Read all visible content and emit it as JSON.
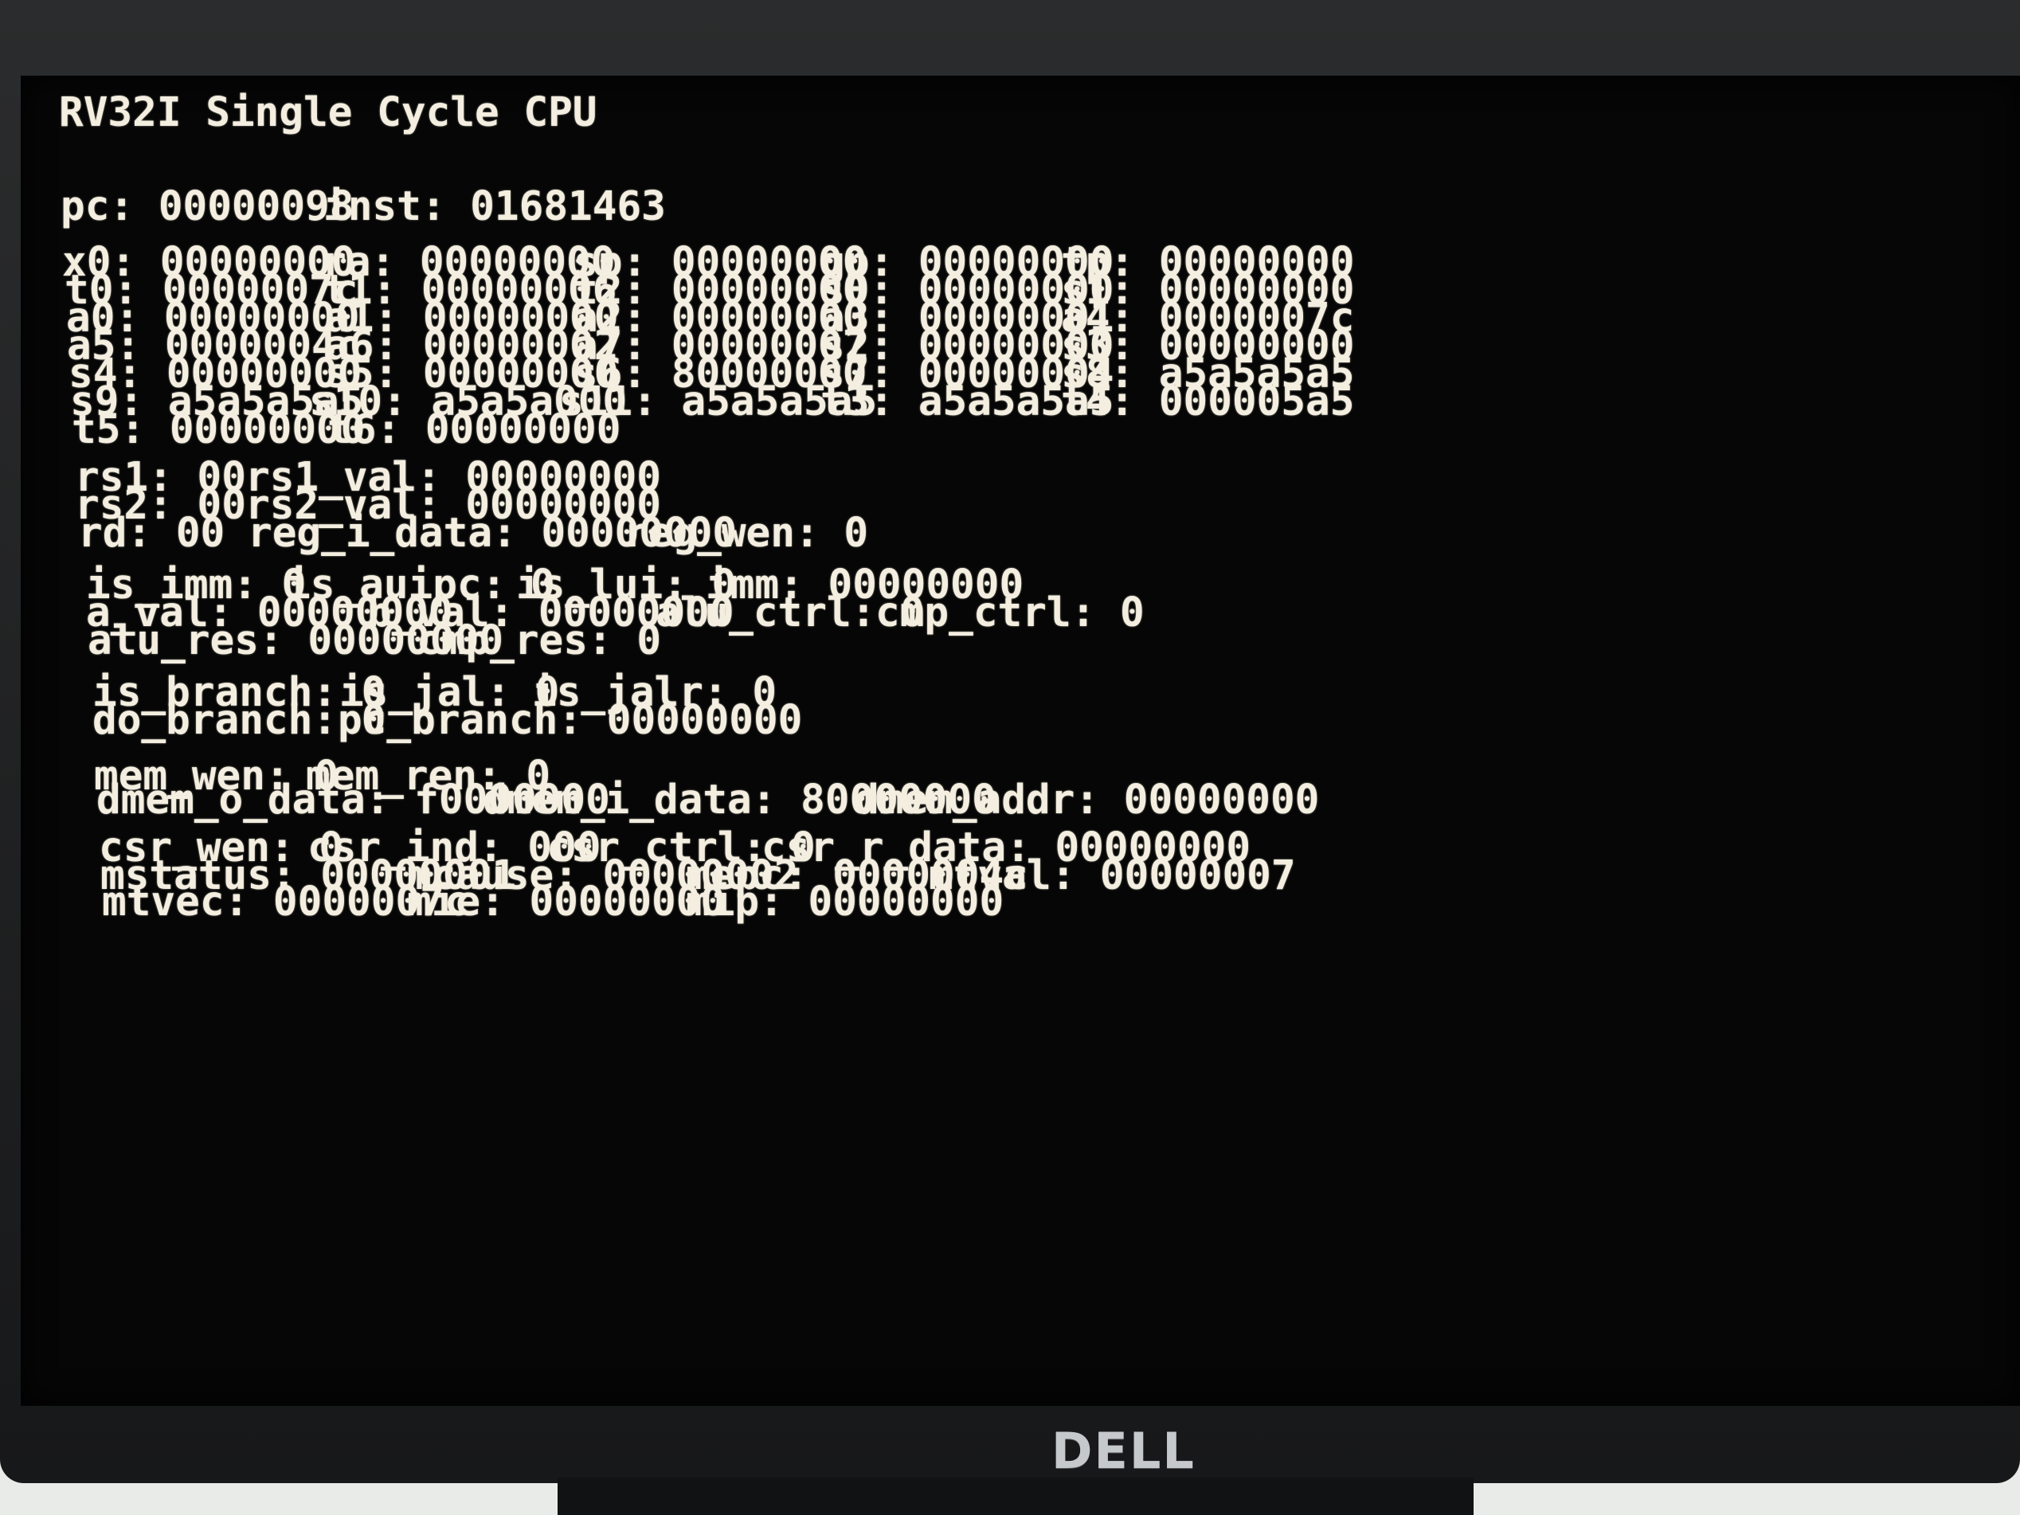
{
  "title": "RV32I Single Cycle CPU",
  "pc_line": [
    {
      "label": "pc:",
      "value": "00000098"
    },
    {
      "label": "inst:",
      "value": "01681463"
    }
  ],
  "registers": [
    [
      {
        "label": "x0:",
        "value": "00000000"
      },
      {
        "label": "ra:",
        "value": "00000000"
      },
      {
        "label": "sp:",
        "value": "00000000"
      },
      {
        "label": "gp:",
        "value": "00000000"
      },
      {
        "label": "tp:",
        "value": "00000000"
      }
    ],
    [
      {
        "label": "t0:",
        "value": "0000007c"
      },
      {
        "label": "t1:",
        "value": "00000006"
      },
      {
        "label": "t2:",
        "value": "00000000"
      },
      {
        "label": "s0:",
        "value": "00000000"
      },
      {
        "label": "s1:",
        "value": "00000000"
      }
    ],
    [
      {
        "label": "a0:",
        "value": "00000000"
      },
      {
        "label": "a1:",
        "value": "00000000"
      },
      {
        "label": "a2:",
        "value": "00000000"
      },
      {
        "label": "a3:",
        "value": "00000001"
      },
      {
        "label": "a4:",
        "value": "0000007c"
      }
    ],
    [
      {
        "label": "a5:",
        "value": "0000004c"
      },
      {
        "label": "a6:",
        "value": "00000002"
      },
      {
        "label": "a7:",
        "value": "00000007"
      },
      {
        "label": "s2:",
        "value": "00000000"
      },
      {
        "label": "s3:",
        "value": "00000000"
      }
    ],
    [
      {
        "label": "s4:",
        "value": "00000000"
      },
      {
        "label": "s5:",
        "value": "00000000"
      },
      {
        "label": "s6:",
        "value": "80000000"
      },
      {
        "label": "s7:",
        "value": "00000004"
      },
      {
        "label": "s8:",
        "value": "a5a5a5a5"
      }
    ],
    [
      {
        "label": "s9:",
        "value": "a5a5a5a5"
      },
      {
        "label": "s10:",
        "value": "a5a5a000"
      },
      {
        "label": "s11:",
        "value": "a5a5a5a5"
      },
      {
        "label": "t3:",
        "value": "a5a5a5a5"
      },
      {
        "label": "t4:",
        "value": "000005a5"
      }
    ],
    [
      {
        "label": "t5:",
        "value": "00000000"
      },
      {
        "label": "t6:",
        "value": "00000000"
      }
    ]
  ],
  "regfile": [
    [
      {
        "label": "rs1:",
        "value": "00"
      },
      {
        "label": "rs1_val:",
        "value": "00000000"
      }
    ],
    [
      {
        "label": "rs2:",
        "value": "00"
      },
      {
        "label": "rs2_val:",
        "value": "00000000"
      }
    ],
    [
      {
        "label": "rd:",
        "value": "00"
      },
      {
        "label": "reg_i_data:",
        "value": "00000000"
      },
      {
        "label": "reg_wen:",
        "value": "0"
      }
    ]
  ],
  "alu": [
    [
      {
        "label": "is_imm:",
        "value": "0"
      },
      {
        "label": "is_auipc:",
        "value": "0"
      },
      {
        "label": "is_lui:",
        "value": "0"
      },
      {
        "label": "imm:",
        "value": "00000000"
      }
    ],
    [
      {
        "label": "a_val:",
        "value": "00000000"
      },
      {
        "label": "b_val:",
        "value": "00000000"
      },
      {
        "label": "alu_ctrl:",
        "value": "0"
      },
      {
        "label": "cmp_ctrl:",
        "value": "0"
      }
    ],
    [
      {
        "label": "alu_res:",
        "value": "00000000"
      },
      {
        "label": "cmp_res:",
        "value": "0"
      }
    ]
  ],
  "branch": [
    [
      {
        "label": "is_branch:",
        "value": "0"
      },
      {
        "label": "is_jal:",
        "value": "0"
      },
      {
        "label": "is_jalr:",
        "value": "0"
      }
    ],
    [
      {
        "label": "do_branch:",
        "value": "0"
      },
      {
        "label": "pc_branch:",
        "value": "00000000"
      }
    ]
  ],
  "memory": [
    [
      {
        "label": "mem_wen:",
        "value": "0"
      },
      {
        "label": "mem_ren:",
        "value": "0"
      }
    ],
    [
      {
        "label": "dmem_o_data:",
        "value": "f0000000"
      },
      {
        "label": "dmem_i_data:",
        "value": "80000000"
      },
      {
        "label": "dmem_addr:",
        "value": "00000000"
      }
    ]
  ],
  "csr": [
    [
      {
        "label": "csr_wen:",
        "value": "0"
      },
      {
        "label": "csr_ind:",
        "value": "000"
      },
      {
        "label": "csr_ctrl:",
        "value": "0"
      },
      {
        "label": "csr_r_data:",
        "value": "00000000"
      }
    ],
    [
      {
        "label": "mstatus:",
        "value": "00000001"
      },
      {
        "label": "mcause:",
        "value": "00000002"
      },
      {
        "label": "mepc:",
        "value": "0000004c"
      },
      {
        "label": "mtval:",
        "value": "00000007"
      }
    ],
    [
      {
        "label": "mtvec:",
        "value": "0000007c"
      },
      {
        "label": "mie:",
        "value": "00000000"
      },
      {
        "label": "mip:",
        "value": "00000000"
      }
    ]
  ],
  "brand": "DELL"
}
